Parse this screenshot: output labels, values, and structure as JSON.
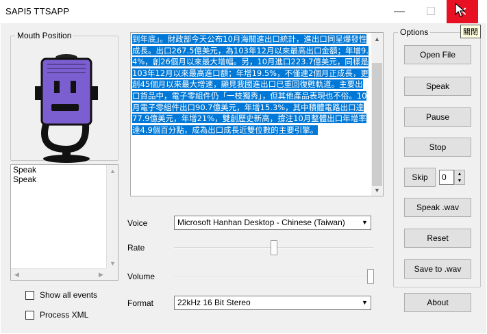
{
  "window": {
    "title": "SAPI5 TTSAPP",
    "minimize_glyph": "—",
    "maximize_glyph": "☐",
    "close_glyph": "✕",
    "close_tooltip": "關閉"
  },
  "mouth": {
    "legend": "Mouth Position",
    "icon": "robot-microphone-icon"
  },
  "events": {
    "items": [
      "Speak",
      "Speak"
    ]
  },
  "checkboxes": {
    "show_all_events": "Show all events",
    "process_xml": "Process XML"
  },
  "text": {
    "content": "到年底」。財政部今天公布10月海關進出口統計，進出口同呈爆發性成長。出口267.5億美元，為103年12月以來最高出口金額；年增9.4%，創26個月以來最大增幅。另，10月進口223.7億美元，同樣是103年12月以來最高進口額；年增19.5%，不僅連2個月正成長，更創45個月以來最大增速，顯見我國進出口已重回復甦軌道。主要出口貨品中，電子零組件仍「一枝獨秀」，但其他產品表現也不俗。10月電子零組件出口90.7億美元，年增15.3%，其中積體電路出口達77.9億美元，年增21%，雙創歷史新高，撐注10月整體出口年增率達4.9個百分點，成為出口成長近雙位數的主要引擎。"
  },
  "controls": {
    "voice_label": "Voice",
    "voice_value": "Microsoft Hanhan Desktop - Chinese (Taiwan)",
    "rate_label": "Rate",
    "rate_level": 0.5,
    "volume_label": "Volume",
    "volume_level": 1.0,
    "format_label": "Format",
    "format_value": "22kHz 16 Bit Stereo"
  },
  "options": {
    "legend": "Options",
    "open_file": "Open File",
    "speak": "Speak",
    "pause": "Pause",
    "stop": "Stop",
    "skip": "Skip",
    "skip_value": "0",
    "speak_wav": "Speak .wav",
    "reset": "Reset",
    "save_wav": "Save to .wav",
    "about": "About"
  },
  "colors": {
    "selection": "#0078d7",
    "close_button": "#e81123",
    "robot_face": "#7b5fd0"
  }
}
